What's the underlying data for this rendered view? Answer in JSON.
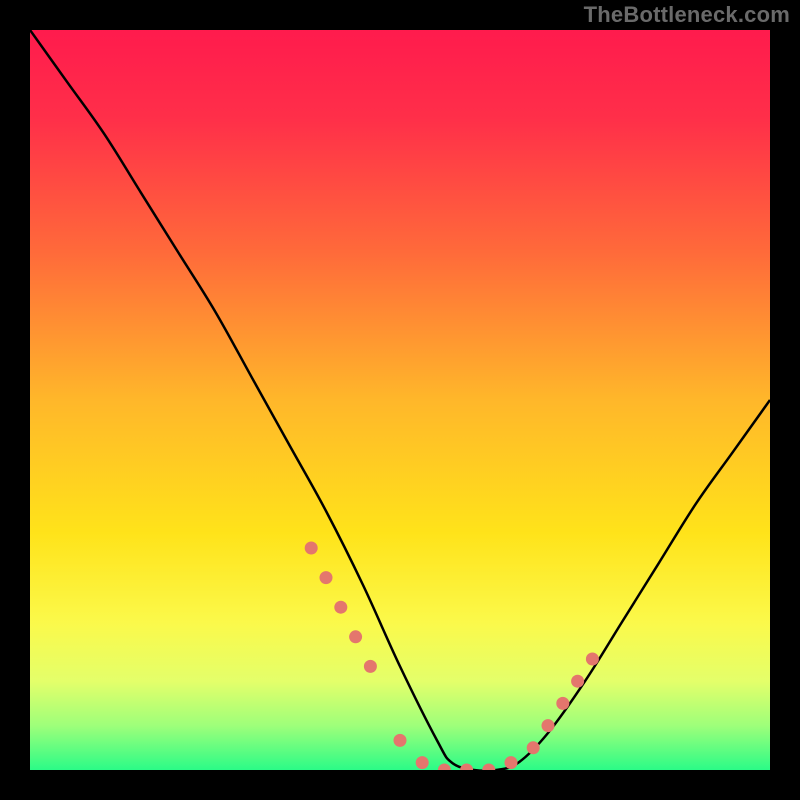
{
  "watermark": "TheBottleneck.com",
  "chart_data": {
    "type": "line",
    "title": "",
    "xlabel": "",
    "ylabel": "",
    "xlim": [
      0,
      100
    ],
    "ylim": [
      0,
      100
    ],
    "gradient_stops": [
      {
        "pos": 0,
        "color": "#ff1b4d"
      },
      {
        "pos": 12,
        "color": "#ff2f49"
      },
      {
        "pos": 30,
        "color": "#ff6a3a"
      },
      {
        "pos": 50,
        "color": "#ffb72a"
      },
      {
        "pos": 68,
        "color": "#ffe31a"
      },
      {
        "pos": 80,
        "color": "#fbf94a"
      },
      {
        "pos": 88,
        "color": "#e4ff6a"
      },
      {
        "pos": 94,
        "color": "#9eff7a"
      },
      {
        "pos": 100,
        "color": "#2bfb87"
      }
    ],
    "series": [
      {
        "name": "bottleneck-curve",
        "x": [
          0,
          5,
          10,
          15,
          20,
          25,
          30,
          35,
          40,
          45,
          50,
          55,
          57,
          60,
          63,
          66,
          70,
          75,
          80,
          85,
          90,
          95,
          100
        ],
        "y": [
          100,
          93,
          86,
          78,
          70,
          62,
          53,
          44,
          35,
          25,
          14,
          4,
          1,
          0,
          0,
          1,
          5,
          12,
          20,
          28,
          36,
          43,
          50
        ]
      }
    ],
    "markers": {
      "name": "highlight-dots",
      "color": "#e4766d",
      "x": [
        38,
        40,
        42,
        44,
        46,
        50,
        53,
        56,
        59,
        62,
        65,
        68,
        70,
        72,
        74,
        76
      ],
      "y": [
        30,
        26,
        22,
        18,
        14,
        4,
        1,
        0,
        0,
        0,
        1,
        3,
        6,
        9,
        12,
        15
      ]
    }
  }
}
